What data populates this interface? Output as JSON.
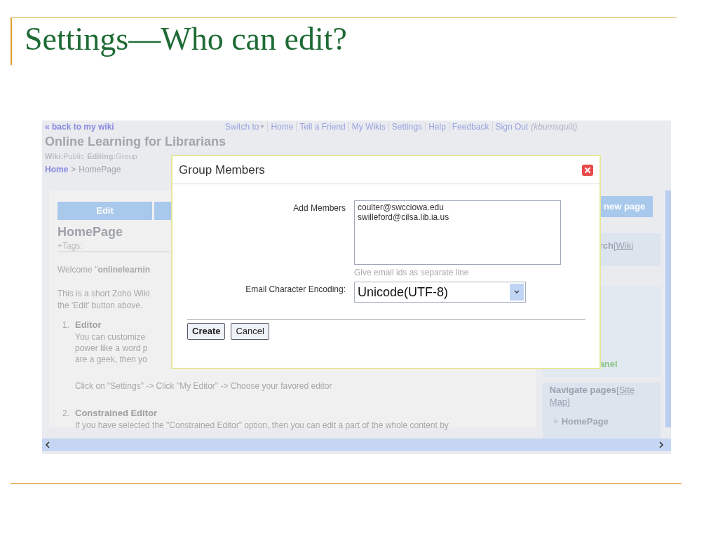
{
  "slide": {
    "title": "Settings—Who can edit?"
  },
  "wiki": {
    "back_link": "« back to my wiki",
    "nav": [
      {
        "label": "Switch to",
        "kind": "dropdown"
      },
      {
        "label": "Home",
        "kind": "link"
      },
      {
        "label": "Tell a Friend",
        "kind": "link"
      },
      {
        "label": "My Wikis",
        "kind": "link"
      },
      {
        "label": "Settings",
        "kind": "link"
      },
      {
        "label": "Help",
        "kind": "link"
      },
      {
        "label": "Feedback",
        "kind": "link"
      },
      {
        "label": "Sign Out",
        "kind": "link"
      }
    ],
    "user": "(kburnsquilt)",
    "title": "Online Learning for Librarians",
    "meta": [
      {
        "key": "Wiki:",
        "value": "Public"
      },
      {
        "key": "Editing:",
        "value": "Group"
      }
    ],
    "breadcrumb": {
      "home": "Home",
      "separator": ">",
      "current": "HomePage"
    },
    "edit_button": "Edit",
    "page_title": "HomePage",
    "tags": "+Tags:",
    "welcome": "Welcome \"**onlinelearnin**",
    "intro": [
      "This is a short Zoho Wiki",
      "the 'Edit' button above."
    ],
    "list": [
      {
        "number": "1.",
        "heading": "Editor",
        "lines": [
          "You can customize",
          "power like a word p",
          "are a geek, then yo"
        ],
        "note": "Click on \"Settings\" -> Click \"My Editor\" -> Choose your favored editor"
      },
      {
        "number": "2.",
        "heading": "Constrained Editor",
        "lines": [
          "If you have selected the \"Constrained Editor\" option, then you can edit a part of the whole content by"
        ]
      }
    ],
    "sidebar": {
      "new_page": "new page",
      "search": {
        "title": "rch",
        "link": "[Wiki"
      },
      "panel": "anel",
      "navigate": {
        "title": "Navigate pages",
        "link": "[Site Map]"
      },
      "pages": [
        "HomePage"
      ]
    }
  },
  "dialog": {
    "title": "Group Members",
    "fields": [
      {
        "kind": "textarea",
        "label": "Add Members",
        "lines": [
          "coulter@swcciowa.edu",
          "swilleford@cilsa.lib.ia.us"
        ],
        "hint": "Give email ids as separate line"
      },
      {
        "kind": "select",
        "label": "Email Character Encoding:",
        "value": "Unicode(UTF-8)"
      }
    ],
    "buttons": [
      {
        "label": "Create",
        "primary": true
      },
      {
        "label": "Cancel",
        "primary": false
      }
    ]
  }
}
